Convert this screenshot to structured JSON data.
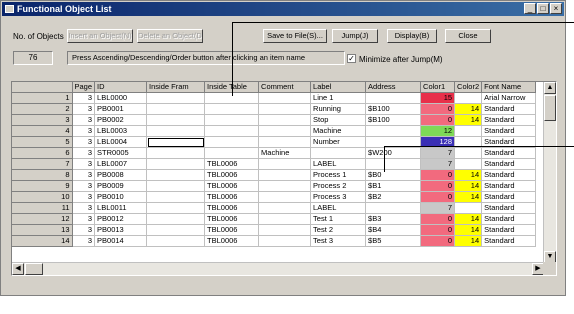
{
  "window": {
    "title": "Functional Object List",
    "minimize_glyph": "_",
    "maximize_glyph": "□",
    "close_glyph": "×"
  },
  "toolbar": {
    "num_objects_label": "No. of Objects",
    "buttons": [
      {
        "label": "Insert an Object(N)",
        "enabled": false
      },
      {
        "label": "Delete an Object(D)",
        "enabled": false
      },
      {
        "label": "Save to File(S)...",
        "enabled": true
      },
      {
        "label": "Jump(J)",
        "enabled": true
      },
      {
        "label": "Display(B)",
        "enabled": true
      },
      {
        "label": "Close",
        "enabled": true
      }
    ],
    "object_count": "76",
    "hint": "Press Ascending/Descending/Order button after clicking an item name",
    "minimize_after_jump": {
      "label": "Minimize after Jump(M)",
      "checked": true
    }
  },
  "grid": {
    "columns": [
      "",
      "Page",
      "ID",
      "Inside Fram",
      "Inside Table",
      "Comment",
      "Label",
      "Address",
      "Color1",
      "Color2",
      "Font Name"
    ],
    "rows": [
      {
        "n": "1",
        "page": "3",
        "id": "LBL0000",
        "fram": "",
        "table": "",
        "comment": "",
        "label": "Line 1",
        "address": "",
        "c1": "15",
        "c1bg": "#e8304a",
        "c2": "",
        "c2bg": "",
        "font": "Arial Narrow"
      },
      {
        "n": "2",
        "page": "3",
        "id": "PB0001",
        "fram": "",
        "table": "",
        "comment": "",
        "label": "Running",
        "address": "$B100",
        "c1": "0",
        "c1bg": "#f26a7e",
        "c2": "14",
        "c2bg": "#ffff00",
        "font": "Standard"
      },
      {
        "n": "3",
        "page": "3",
        "id": "PB0002",
        "fram": "",
        "table": "",
        "comment": "",
        "label": "Stop",
        "address": "$B100",
        "c1": "0",
        "c1bg": "#f26a7e",
        "c2": "14",
        "c2bg": "#ffff00",
        "font": "Standard"
      },
      {
        "n": "4",
        "page": "3",
        "id": "LBL0003",
        "fram": "",
        "table": "",
        "comment": "",
        "label": "Machine",
        "address": "",
        "c1": "12",
        "c1bg": "#7ed957",
        "c2": "",
        "c2bg": "",
        "font": "Standard"
      },
      {
        "n": "5",
        "page": "3",
        "id": "LBL0004",
        "fram": "",
        "table": "",
        "comment": "",
        "label": "Number",
        "address": "",
        "c1": "128",
        "c1bg": "#3a2fb5",
        "c2": "",
        "c2bg": "",
        "font": "Standard"
      },
      {
        "n": "6",
        "page": "3",
        "id": "STR0005",
        "fram": "",
        "table": "",
        "comment": "Machine",
        "label": "",
        "address": "$W200",
        "c1": "7",
        "c1bg": "#c8c8c8",
        "c2": "",
        "c2bg": "",
        "font": "Standard"
      },
      {
        "n": "7",
        "page": "3",
        "id": "LBL0007",
        "fram": "",
        "table": "TBL0006",
        "comment": "",
        "label": "LABEL",
        "address": "",
        "c1": "7",
        "c1bg": "#c8c8c8",
        "c2": "",
        "c2bg": "",
        "font": "Standard"
      },
      {
        "n": "8",
        "page": "3",
        "id": "PB0008",
        "fram": "",
        "table": "TBL0006",
        "comment": "",
        "label": "Process 1",
        "address": "$B0",
        "c1": "0",
        "c1bg": "#f26a7e",
        "c2": "14",
        "c2bg": "#ffff00",
        "font": "Standard"
      },
      {
        "n": "9",
        "page": "3",
        "id": "PB0009",
        "fram": "",
        "table": "TBL0006",
        "comment": "",
        "label": "Process 2",
        "address": "$B1",
        "c1": "0",
        "c1bg": "#f26a7e",
        "c2": "14",
        "c2bg": "#ffff00",
        "font": "Standard"
      },
      {
        "n": "10",
        "page": "3",
        "id": "PB0010",
        "fram": "",
        "table": "TBL0006",
        "comment": "",
        "label": "Process 3",
        "address": "$B2",
        "c1": "0",
        "c1bg": "#f26a7e",
        "c2": "14",
        "c2bg": "#ffff00",
        "font": "Standard"
      },
      {
        "n": "11",
        "page": "3",
        "id": "LBL0011",
        "fram": "",
        "table": "TBL0006",
        "comment": "",
        "label": "LABEL",
        "address": "",
        "c1": "7",
        "c1bg": "#c8c8c8",
        "c2": "",
        "c2bg": "",
        "font": "Standard"
      },
      {
        "n": "12",
        "page": "3",
        "id": "PB0012",
        "fram": "",
        "table": "TBL0006",
        "comment": "",
        "label": "Test 1",
        "address": "$B3",
        "c1": "0",
        "c1bg": "#f26a7e",
        "c2": "14",
        "c2bg": "#ffff00",
        "font": "Standard"
      },
      {
        "n": "13",
        "page": "3",
        "id": "PB0013",
        "fram": "",
        "table": "TBL0006",
        "comment": "",
        "label": "Test 2",
        "address": "$B4",
        "c1": "0",
        "c1bg": "#f26a7e",
        "c2": "14",
        "c2bg": "#ffff00",
        "font": "Standard"
      },
      {
        "n": "14",
        "page": "3",
        "id": "PB0014",
        "fram": "",
        "table": "TBL0006",
        "comment": "",
        "label": "Test 3",
        "address": "$B5",
        "c1": "0",
        "c1bg": "#f26a7e",
        "c2": "14",
        "c2bg": "#ffff00",
        "font": "Standard"
      }
    ]
  },
  "icons": {
    "scroll_up": "▲",
    "scroll_down": "▼",
    "scroll_left": "◀",
    "scroll_right": "▶",
    "check": "✓"
  }
}
